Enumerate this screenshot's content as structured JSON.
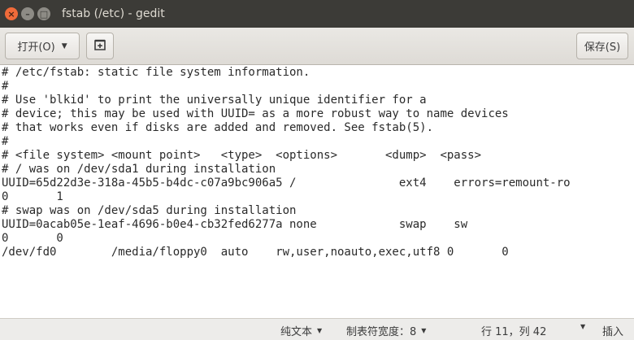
{
  "window": {
    "title": "fstab (/etc) - gedit",
    "close_glyph": "×",
    "minimize_glyph": "–",
    "maximize_glyph": "□"
  },
  "toolbar": {
    "open_label": "打开(O)",
    "open_arrow": "▼",
    "save_label": "保存(S)"
  },
  "editor": {
    "lines": [
      "# /etc/fstab: static file system information.",
      "#",
      "# Use 'blkid' to print the universally unique identifier for a",
      "# device; this may be used with UUID= as a more robust way to name devices",
      "# that works even if disks are added and removed. See fstab(5).",
      "#",
      "# <file system> <mount point>   <type>  <options>       <dump>  <pass>",
      "# / was on /dev/sda1 during installation",
      "UUID=65d22d3e-318a-45b5-b4dc-c07a9bc906a5 /               ext4    errors=remount-ro",
      "0       1",
      "# swap was on /dev/sda5 during installation",
      "UUID=0acab05e-1eaf-4696-b0e4-cb32fed6277a none            swap    sw",
      "0       0",
      "/dev/fd0        /media/floppy0  auto    rw,user,noauto,exec,utf8 0       0"
    ]
  },
  "statusbar": {
    "language": "纯文本",
    "tab_width": "制表符宽度：8",
    "cursor_position": "行 11，列 42",
    "insert_mode": "插入",
    "dropdown_glyph": "▼"
  },
  "icons": {
    "new_document": "new-document-icon"
  },
  "colors": {
    "titlebar_bg": "#3c3b37",
    "close_button": "#f06b3a",
    "toolbar_bg": "#e6e3df",
    "editor_bg": "#ffffff",
    "statusbar_bg": "#edecea"
  }
}
